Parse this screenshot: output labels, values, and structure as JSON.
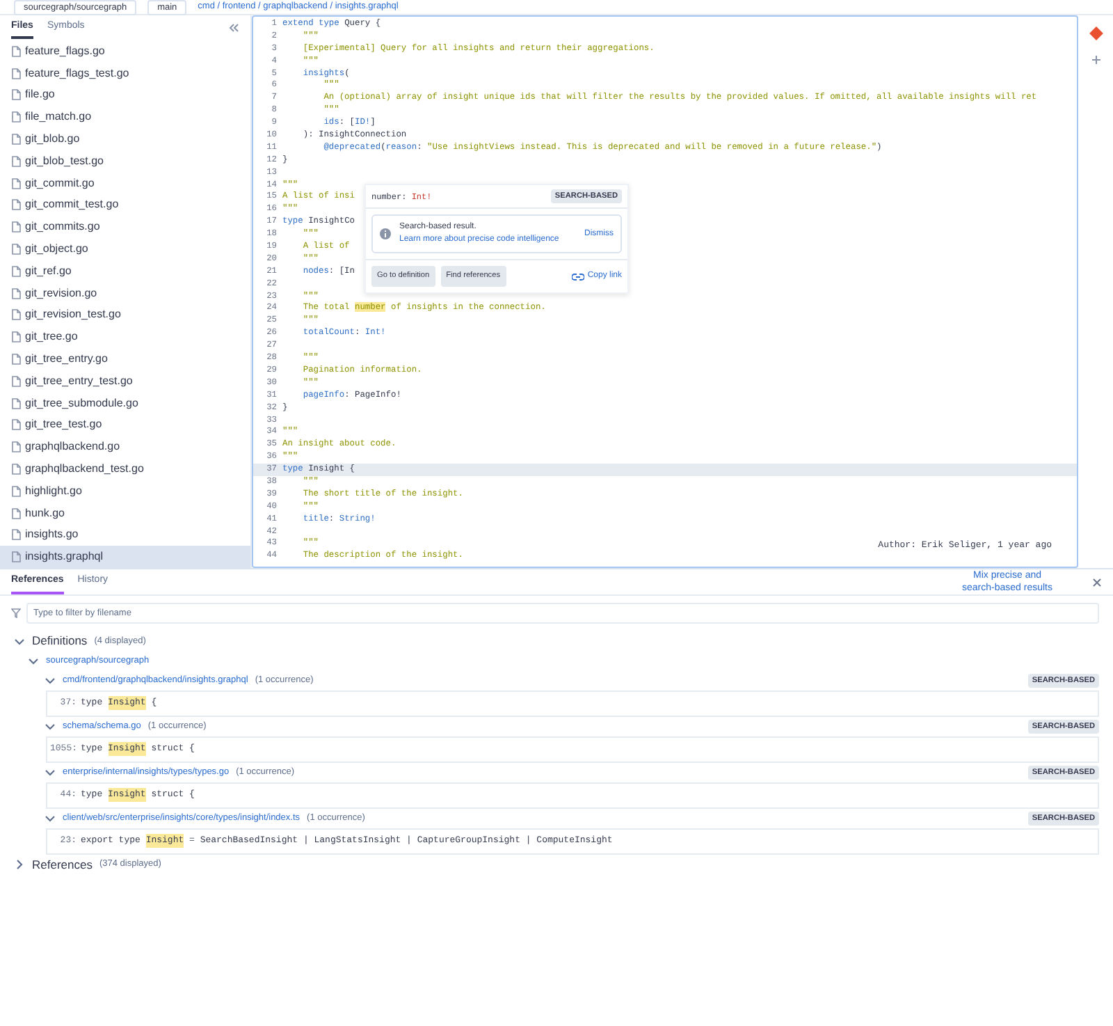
{
  "top_bar": {
    "repo": "sourcegraph/sourcegraph",
    "branch": "main",
    "breadcrumb": "cmd / frontend / graphqlbackend / insights.graphql"
  },
  "sidebar": {
    "tabs": [
      {
        "label": "Files",
        "selected": true
      },
      {
        "label": "Symbols",
        "selected": false
      }
    ],
    "files": [
      {
        "name": "feature_flags.go",
        "selected": false
      },
      {
        "name": "feature_flags_test.go",
        "selected": false
      },
      {
        "name": "file.go",
        "selected": false
      },
      {
        "name": "file_match.go",
        "selected": false
      },
      {
        "name": "git_blob.go",
        "selected": false
      },
      {
        "name": "git_blob_test.go",
        "selected": false
      },
      {
        "name": "git_commit.go",
        "selected": false
      },
      {
        "name": "git_commit_test.go",
        "selected": false
      },
      {
        "name": "git_commits.go",
        "selected": false
      },
      {
        "name": "git_object.go",
        "selected": false
      },
      {
        "name": "git_ref.go",
        "selected": false
      },
      {
        "name": "git_revision.go",
        "selected": false
      },
      {
        "name": "git_revision_test.go",
        "selected": false
      },
      {
        "name": "git_tree.go",
        "selected": false
      },
      {
        "name": "git_tree_entry.go",
        "selected": false
      },
      {
        "name": "git_tree_entry_test.go",
        "selected": false
      },
      {
        "name": "git_tree_submodule.go",
        "selected": false
      },
      {
        "name": "git_tree_test.go",
        "selected": false
      },
      {
        "name": "graphqlbackend.go",
        "selected": false
      },
      {
        "name": "graphqlbackend_test.go",
        "selected": false
      },
      {
        "name": "highlight.go",
        "selected": false
      },
      {
        "name": "hunk.go",
        "selected": false
      },
      {
        "name": "insights.go",
        "selected": false
      },
      {
        "name": "insights.graphql",
        "selected": true
      }
    ]
  },
  "code": {
    "lines": [
      {
        "number": "1",
        "selected": false,
        "tokens": [
          {
            "kind": "keyword",
            "text": "extend type"
          },
          {
            "kind": "plain",
            "text": " Query {"
          }
        ]
      },
      {
        "number": "2",
        "selected": false,
        "tokens": [
          {
            "kind": "string",
            "text": "    \"\"\""
          }
        ]
      },
      {
        "number": "3",
        "selected": false,
        "tokens": [
          {
            "kind": "string",
            "text": "    [Experimental] Query for all insights and return their aggregations."
          }
        ]
      },
      {
        "number": "4",
        "selected": false,
        "tokens": [
          {
            "kind": "string",
            "text": "    \"\"\""
          }
        ]
      },
      {
        "number": "5",
        "selected": false,
        "tokens": [
          {
            "kind": "keyword",
            "text": "    insights"
          },
          {
            "kind": "plain",
            "text": "("
          }
        ]
      },
      {
        "number": "6",
        "selected": false,
        "tokens": [
          {
            "kind": "string",
            "text": "        \"\"\""
          }
        ]
      },
      {
        "number": "7",
        "selected": false,
        "tokens": [
          {
            "kind": "string",
            "text": "        An (optional) array of insight unique ids that will filter the results by the provided values. If omitted, all available insights will ret"
          }
        ]
      },
      {
        "number": "8",
        "selected": false,
        "tokens": [
          {
            "kind": "string",
            "text": "        \"\"\""
          }
        ]
      },
      {
        "number": "9",
        "selected": false,
        "tokens": [
          {
            "kind": "keyword",
            "text": "        ids"
          },
          {
            "kind": "plain",
            "text": ": ["
          },
          {
            "kind": "keyword",
            "text": "ID!"
          },
          {
            "kind": "plain",
            "text": "]"
          }
        ]
      },
      {
        "number": "10",
        "selected": false,
        "tokens": [
          {
            "kind": "plain",
            "text": "    ): InsightConnection"
          }
        ]
      },
      {
        "number": "11",
        "selected": false,
        "tokens": [
          {
            "kind": "keyword",
            "text": "        @deprecated"
          },
          {
            "kind": "plain",
            "text": "("
          },
          {
            "kind": "keyword",
            "text": "reason"
          },
          {
            "kind": "plain",
            "text": ": "
          },
          {
            "kind": "string",
            "text": "\"Use insightViews instead. This is deprecated and will be removed in a future release.\""
          },
          {
            "kind": "plain",
            "text": ")"
          }
        ]
      },
      {
        "number": "12",
        "selected": false,
        "tokens": [
          {
            "kind": "plain",
            "text": "}"
          }
        ]
      },
      {
        "number": "13",
        "selected": false
      },
      {
        "number": "14",
        "selected": false,
        "tokens": [
          {
            "kind": "string",
            "text": "\"\"\""
          }
        ]
      },
      {
        "number": "15",
        "selected": false,
        "tokens": [
          {
            "kind": "string",
            "text": "A list of insi"
          }
        ]
      },
      {
        "number": "16",
        "selected": false,
        "tokens": [
          {
            "kind": "string",
            "text": "\"\"\""
          }
        ]
      },
      {
        "number": "17",
        "selected": false,
        "tokens": [
          {
            "kind": "keyword",
            "text": "type"
          },
          {
            "kind": "plain",
            "text": " InsightCo"
          }
        ]
      },
      {
        "number": "18",
        "selected": false,
        "tokens": [
          {
            "kind": "string",
            "text": "    \"\"\""
          }
        ]
      },
      {
        "number": "19",
        "selected": false,
        "tokens": [
          {
            "kind": "string",
            "text": "    A list of"
          }
        ]
      },
      {
        "number": "20",
        "selected": false,
        "tokens": [
          {
            "kind": "string",
            "text": "    \"\"\""
          }
        ]
      },
      {
        "number": "21",
        "selected": false,
        "tokens": [
          {
            "kind": "keyword",
            "text": "    nodes"
          },
          {
            "kind": "plain",
            "text": ": [In"
          }
        ]
      },
      {
        "number": "22",
        "selected": false
      },
      {
        "number": "23",
        "selected": false,
        "tokens": [
          {
            "kind": "string",
            "text": "    \"\"\""
          }
        ]
      },
      {
        "number": "24",
        "selected": false,
        "tokens": [
          {
            "kind": "string",
            "text": "    The total "
          },
          {
            "kind": "match",
            "text": "number"
          },
          {
            "kind": "string",
            "text": " of insights in the connection."
          }
        ]
      },
      {
        "number": "25",
        "selected": false,
        "tokens": [
          {
            "kind": "string",
            "text": "    \"\"\""
          }
        ]
      },
      {
        "number": "26",
        "selected": false,
        "tokens": [
          {
            "kind": "keyword",
            "text": "    totalCount"
          },
          {
            "kind": "plain",
            "text": ": "
          },
          {
            "kind": "keyword",
            "text": "Int!"
          }
        ]
      },
      {
        "number": "27",
        "selected": false
      },
      {
        "number": "28",
        "selected": false,
        "tokens": [
          {
            "kind": "string",
            "text": "    \"\"\""
          }
        ]
      },
      {
        "number": "29",
        "selected": false,
        "tokens": [
          {
            "kind": "string",
            "text": "    Pagination information."
          }
        ]
      },
      {
        "number": "30",
        "selected": false,
        "tokens": [
          {
            "kind": "string",
            "text": "    \"\"\""
          }
        ]
      },
      {
        "number": "31",
        "selected": false,
        "tokens": [
          {
            "kind": "keyword",
            "text": "    pageInfo"
          },
          {
            "kind": "plain",
            "text": ": PageInfo!"
          }
        ]
      },
      {
        "number": "32",
        "selected": false,
        "tokens": [
          {
            "kind": "plain",
            "text": "}"
          }
        ]
      },
      {
        "number": "33",
        "selected": false
      },
      {
        "number": "34",
        "selected": false,
        "tokens": [
          {
            "kind": "string",
            "text": "\"\"\""
          }
        ]
      },
      {
        "number": "35",
        "selected": false,
        "tokens": [
          {
            "kind": "string",
            "text": "An insight about code."
          }
        ]
      },
      {
        "number": "36",
        "selected": false,
        "tokens": [
          {
            "kind": "string",
            "text": "\"\"\""
          }
        ]
      },
      {
        "number": "37",
        "selected": true,
        "tokens": [
          {
            "kind": "keyword",
            "text": "type"
          },
          {
            "kind": "plain",
            "text": " Insight {"
          }
        ]
      },
      {
        "number": "38",
        "selected": false,
        "tokens": [
          {
            "kind": "string",
            "text": "    \"\"\""
          }
        ]
      },
      {
        "number": "39",
        "selected": false,
        "tokens": [
          {
            "kind": "string",
            "text": "    The short title of the insight."
          }
        ]
      },
      {
        "number": "40",
        "selected": false,
        "tokens": [
          {
            "kind": "string",
            "text": "    \"\"\""
          }
        ]
      },
      {
        "number": "41",
        "selected": false,
        "tokens": [
          {
            "kind": "keyword",
            "text": "    title"
          },
          {
            "kind": "plain",
            "text": ": "
          },
          {
            "kind": "keyword",
            "text": "String!"
          }
        ]
      },
      {
        "number": "42",
        "selected": false
      },
      {
        "number": "43",
        "selected": false,
        "tokens": [
          {
            "kind": "string",
            "text": "    \"\"\""
          }
        ]
      },
      {
        "number": "44",
        "selected": false,
        "tokens": [
          {
            "kind": "string",
            "text": "    The description of the insight."
          }
        ]
      }
    ],
    "blame": "Author: Erik Seliger, 1 year ago"
  },
  "hover_popover": {
    "signature": [
      {
        "kind": "plain",
        "text": "number: "
      },
      {
        "kind": "type",
        "text": "Int!"
      }
    ],
    "badge": "SEARCH-BASED",
    "notice": {
      "title": "Search-based result.",
      "link": "Learn more about precise code intelligence",
      "dismiss": "Dismiss"
    },
    "actions": [
      "Go to definition",
      "Find references"
    ],
    "copy_link": "Copy link"
  },
  "bottom_panel": {
    "tabs": [
      {
        "label": "References",
        "selected": true
      },
      {
        "label": "History",
        "selected": false
      }
    ],
    "mix_link": "Mix precise and search-based results",
    "filter": {
      "placeholder": "Type to filter by filename"
    },
    "groups": [
      {
        "title": "Definitions",
        "count": "(4 displayed)",
        "expanded": true,
        "repos": [
          {
            "name": "sourcegraph/sourcegraph",
            "expanded": true,
            "files": [
              {
                "path": "cmd/frontend/graphqlbackend/insights.graphql",
                "occurrences": "(1 occurrence)",
                "expanded": true,
                "badge": "SEARCH-BASED",
                "lines": [
                  {
                    "number": "37:",
                    "tokens": [
                      {
                        "kind": "plain",
                        "text": "type "
                      },
                      {
                        "kind": "match",
                        "text": "Insight"
                      },
                      {
                        "kind": "plain",
                        "text": " {"
                      }
                    ]
                  }
                ]
              },
              {
                "path": "schema/schema.go",
                "occurrences": "(1 occurrence)",
                "expanded": true,
                "badge": "SEARCH-BASED",
                "lines": [
                  {
                    "number": "1055:",
                    "tokens": [
                      {
                        "kind": "plain",
                        "text": "type "
                      },
                      {
                        "kind": "match",
                        "text": "Insight"
                      },
                      {
                        "kind": "plain",
                        "text": " struct {"
                      }
                    ]
                  }
                ]
              },
              {
                "path": "enterprise/internal/insights/types/types.go",
                "occurrences": "(1 occurrence)",
                "expanded": true,
                "badge": "SEARCH-BASED",
                "lines": [
                  {
                    "number": "44:",
                    "tokens": [
                      {
                        "kind": "plain",
                        "text": "type "
                      },
                      {
                        "kind": "match",
                        "text": "Insight"
                      },
                      {
                        "kind": "plain",
                        "text": " struct {"
                      }
                    ]
                  }
                ]
              },
              {
                "path": "client/web/src/enterprise/insights/core/types/insight/index.ts",
                "occurrences": "(1 occurrence)",
                "expanded": true,
                "badge": "SEARCH-BASED",
                "lines": [
                  {
                    "number": "23:",
                    "tokens": [
                      {
                        "kind": "plain",
                        "text": "export type "
                      },
                      {
                        "kind": "match",
                        "text": "Insight"
                      },
                      {
                        "kind": "plain",
                        "text": " = SearchBasedInsight | LangStatsInsight | CaptureGroupInsight | ComputeInsight"
                      }
                    ]
                  }
                ]
              }
            ]
          }
        ]
      },
      {
        "title": "References",
        "count": "(374 displayed)",
        "expanded": false
      }
    ]
  }
}
